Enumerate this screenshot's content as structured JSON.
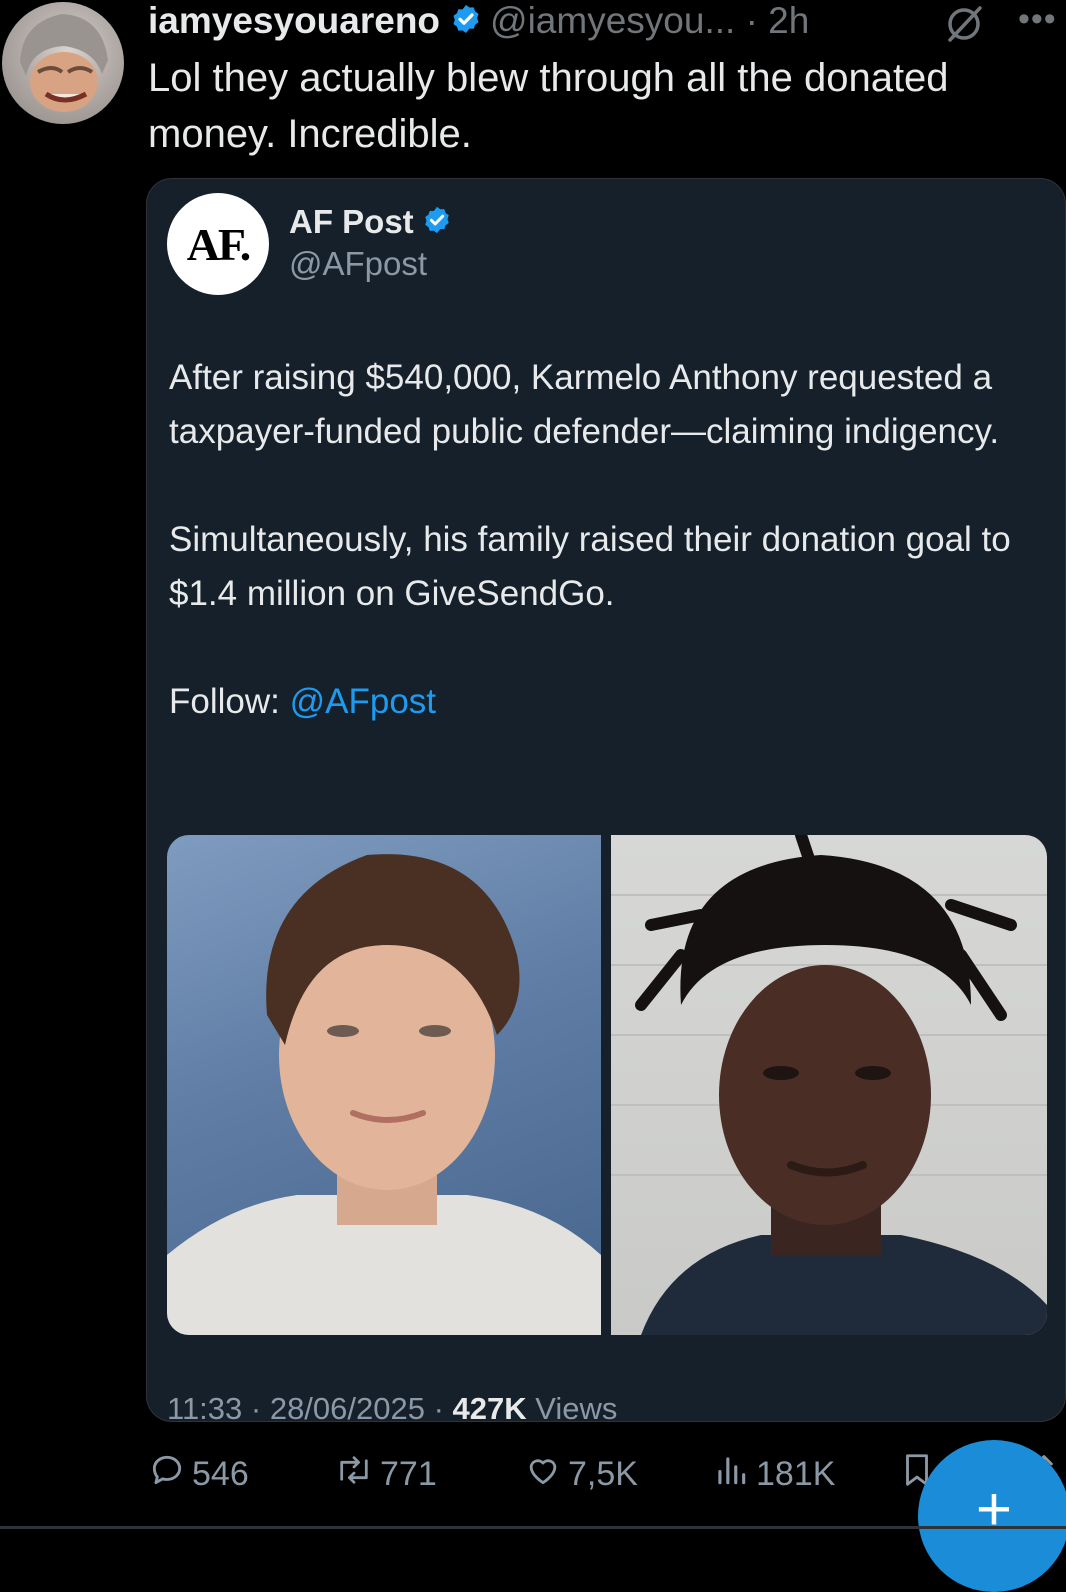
{
  "post": {
    "author_name": "iamyesyouareno",
    "handle_time": "@iamyesyou... · 2h",
    "text": "Lol they actually blew through all the donated money. Incredible."
  },
  "quote": {
    "avatar_text": "AF.",
    "author_name": "AF Post",
    "handle": "@AFpost",
    "paragraph1": "After raising $540,000, Karmelo Anthony requested a taxpayer-funded public defender—claiming indigency.",
    "paragraph2": "Simultaneously, his family raised their donation goal to $1.4 million on GiveSendGo.",
    "follow_label": "Follow: ",
    "follow_handle": "@AFpost",
    "meta_prefix": "11:33 · 28/06/2025 · ",
    "views_count": "427K",
    "views_label": " Views"
  },
  "actions": {
    "replies": "546",
    "reposts": "771",
    "likes": "7,5K",
    "views": "181K"
  },
  "fab_label": "+",
  "colors": {
    "background": "#000000",
    "card": "#15202b",
    "accent": "#1d9bf0",
    "muted": "#71767b"
  },
  "icons": [
    "verified-badge-icon",
    "grok-icon",
    "more-icon",
    "reply-icon",
    "repost-icon",
    "like-icon",
    "views-icon",
    "bookmark-icon",
    "share-icon",
    "compose-plus-icon"
  ]
}
